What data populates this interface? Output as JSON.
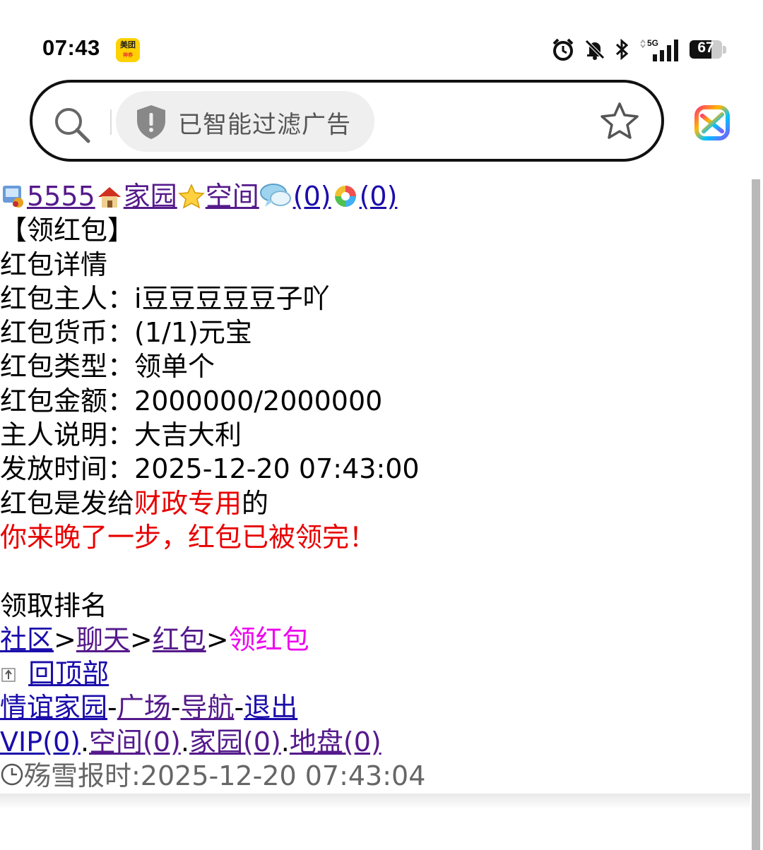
{
  "status_bar": {
    "time": "07:43",
    "app_badge": "美团",
    "app_badge_sub": "神券",
    "network": "5G",
    "battery": "67",
    "battery_level": 0.67
  },
  "address_bar": {
    "ad_filter_label": "已智能过滤广告"
  },
  "header_links": {
    "user": "5555",
    "home": "家园",
    "space": "空间",
    "msg_count": "(0)",
    "photo_count": "(0)"
  },
  "page": {
    "title": "【领红包】",
    "section": "红包详情",
    "owner_label": "红包主人：",
    "owner_value": "i豆豆豆豆豆子吖",
    "currency_label": "红包货币：",
    "currency_value": "(1/1)元宝",
    "type_label": "红包类型：",
    "type_value": "领单个",
    "amount_label": "红包金额：",
    "amount_value": "2000000/2000000",
    "note_label": "主人说明：",
    "note_value": "大吉大利",
    "time_label": "发放时间：",
    "time_value": "2025-12-20 07:43:00",
    "target_prefix": "红包是发给",
    "target_name": "财政专用",
    "target_suffix": "的",
    "notice": "你来晚了一步，红包已被领完！",
    "ranking_label": "领取排名"
  },
  "breadcrumb": {
    "items": [
      "社区",
      "聊天",
      "红包"
    ],
    "sep": ">",
    "current": "领红包"
  },
  "footer": {
    "back_top": "回顶部",
    "nav1": [
      "情谊家园",
      "广场",
      "导航",
      "退出"
    ],
    "nav_sep": "-",
    "nav2": [
      "VIP(0)",
      "空间(0)",
      "家园(0)",
      "地盘(0)"
    ],
    "dot_sep": ".",
    "clock_text": "殇雪报时:2025-12-20 07:43:04"
  },
  "colors": {
    "link": "#1a0dab",
    "visited": "#551a8b",
    "alert": "#e80000",
    "current": "#ee00ee"
  }
}
